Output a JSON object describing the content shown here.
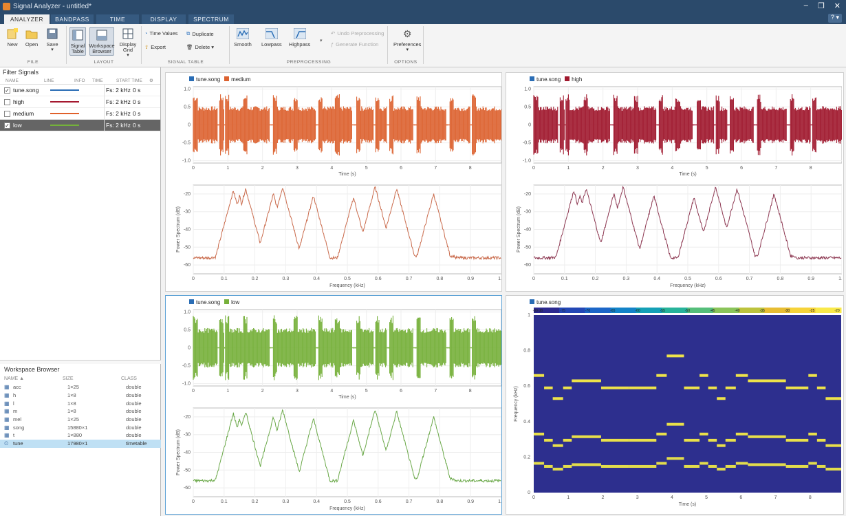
{
  "window": {
    "title": "Signal Analyzer - untitled*",
    "controls": [
      "–",
      "❐",
      "✕"
    ]
  },
  "tabs": [
    "ANALYZER",
    "BANDPASS",
    "TIME",
    "DISPLAY",
    "SPECTRUM"
  ],
  "help_label": "? ▾",
  "ribbon": {
    "buttons": {
      "new": "New",
      "open": "Open",
      "save": "Save",
      "signal_table": "Signal Table",
      "workspace_browser": "Workspace Browser",
      "display_grid": "Display Grid",
      "smooth": "Smooth",
      "lowpass": "Lowpass",
      "highpass": "Highpass",
      "preferences": "Preferences"
    },
    "small": {
      "time_values": "Time Values",
      "duplicate": "Duplicate",
      "export": "Export",
      "delete": "Delete ▾",
      "undo_preprocessing": "Undo Preprocessing",
      "generate_function": "Generate Function"
    },
    "sections": [
      "FILE",
      "LAYOUT",
      "SIGNAL TABLE",
      "PREPROCESSING",
      "OPTIONS"
    ]
  },
  "filter": {
    "title": "Filter Signals",
    "columns": [
      "NAME",
      "LINE",
      "INFO",
      "TIME",
      "START TIME"
    ],
    "rows": [
      {
        "check": "✓",
        "name": "tune.song",
        "color": "#2a6db5",
        "info": "Fs: 2 kHz",
        "start": "0 s"
      },
      {
        "check": "",
        "name": "high",
        "color": "#a5182f",
        "info": "Fs: 2 kHz",
        "start": "0 s"
      },
      {
        "check": "",
        "name": "medium",
        "color": "#e0602a",
        "info": "Fs: 2 kHz",
        "start": "0 s"
      },
      {
        "check": "✓",
        "name": "low",
        "color": "#74b23a",
        "info": "Fs: 2 kHz",
        "start": "0 s"
      }
    ]
  },
  "workspace": {
    "title": "Workspace Browser",
    "columns": [
      "NAME ▲",
      "SIZE",
      "CLASS"
    ],
    "rows": [
      {
        "name": "acc",
        "size": "1×25",
        "cls": "double"
      },
      {
        "name": "h",
        "size": "1×8",
        "cls": "double"
      },
      {
        "name": "l",
        "size": "1×8",
        "cls": "double"
      },
      {
        "name": "m",
        "size": "1×8",
        "cls": "double"
      },
      {
        "name": "mel",
        "size": "1×25",
        "cls": "double"
      },
      {
        "name": "song",
        "size": "15880×1",
        "cls": "double"
      },
      {
        "name": "t",
        "size": "1×880",
        "cls": "double"
      },
      {
        "name": "tune",
        "size": "17980×1",
        "cls": "timetable"
      }
    ]
  },
  "colors": {
    "blue": "#2a6db5",
    "medium": "#dc6230",
    "high": "#a0182e",
    "low": "#76b03a",
    "spec_bg": "#2d2f8e",
    "note": "#eee34a",
    "spec_medium": "#c96a4b",
    "spec_high": "#8c3650",
    "spec_low": "#6aa848"
  },
  "panels": [
    {
      "legend": [
        "tune.song",
        "medium"
      ],
      "time_xlabel": "Time (s)",
      "freq_xlabel": "Frequency (kHz)",
      "freq_ylabel": "Power Spectrum (dB)"
    },
    {
      "legend": [
        "tune.song",
        "high"
      ],
      "time_xlabel": "Time (s)",
      "freq_xlabel": "Frequency (kHz)",
      "freq_ylabel": "Power Spectrum (dB)"
    },
    {
      "legend": [
        "tune.song",
        "low"
      ],
      "time_xlabel": "Time (s)",
      "freq_xlabel": "Frequency (kHz)",
      "freq_ylabel": "Power Spectrum (dB)"
    },
    {
      "legend": [
        "tune.song"
      ],
      "xlabel": "Time (s)",
      "ylabel": "Frequency (kHz)"
    }
  ],
  "axes": {
    "time_x": [
      "0",
      "1",
      "2",
      "3",
      "4",
      "5",
      "6",
      "7",
      "8"
    ],
    "time_y": [
      "1.0",
      "0.5",
      "0",
      "-0.5",
      "-1.0"
    ],
    "freq_x": [
      "0",
      "0.1",
      "0.2",
      "0.3",
      "0.4",
      "0.5",
      "0.6",
      "0.7",
      "0.8",
      "0.9",
      "1.0"
    ],
    "freq_y": [
      "-20",
      "-30",
      "-40",
      "-50",
      "-60"
    ],
    "spec_y": [
      "1",
      "0.8",
      "0.6",
      "0.4",
      "0.2",
      "0"
    ],
    "spec_x": [
      "0",
      "1",
      "2",
      "3",
      "4",
      "5",
      "6",
      "7",
      "8"
    ],
    "colorbar": [
      "-80 dB",
      "-75",
      "-70",
      "-65",
      "-60",
      "-55",
      "-50",
      "-45",
      "-40",
      "-35",
      "-30",
      "-25",
      "-20"
    ]
  },
  "chart_data": [
    {
      "type": "line",
      "title": "",
      "xlabel": "Time (s)",
      "ylabel": "",
      "xlim": [
        0,
        8.9
      ],
      "ylim": [
        -1,
        1
      ],
      "series": [
        {
          "name": "tune.song"
        },
        {
          "name": "medium"
        }
      ],
      "amplitude_level": 0.4,
      "note_bursts": [
        [
          0.0,
          0.7
        ],
        [
          0.75,
          0.9
        ],
        [
          0.92,
          1.45
        ],
        [
          1.45,
          2.2
        ],
        [
          2.3,
          2.9
        ],
        [
          2.9,
          3.55
        ],
        [
          3.6,
          4.1
        ],
        [
          4.1,
          4.6
        ],
        [
          4.7,
          5.2
        ],
        [
          5.25,
          5.6
        ],
        [
          5.65,
          6.35
        ],
        [
          6.45,
          7.3
        ],
        [
          7.4,
          8.0
        ],
        [
          8.05,
          8.9
        ]
      ]
    },
    {
      "type": "line",
      "xlabel": "Frequency (kHz)",
      "ylabel": "Power Spectrum (dB)",
      "xlim": [
        0,
        1
      ],
      "ylim": [
        -65,
        -15
      ],
      "peaks": [
        [
          0.13,
          -18
        ],
        [
          0.15,
          -21
        ],
        [
          0.17,
          -17
        ],
        [
          0.26,
          -20
        ],
        [
          0.29,
          -16
        ],
        [
          0.39,
          -21
        ],
        [
          0.52,
          -22
        ],
        [
          0.59,
          -16
        ],
        [
          0.66,
          -17
        ],
        [
          0.78,
          -20
        ]
      ]
    },
    {
      "type": "heatmap",
      "xlabel": "Time (s)",
      "ylabel": "Frequency (kHz)",
      "xlim": [
        0,
        8.9
      ],
      "ylim": [
        0,
        1
      ],
      "notes": [
        [
          0,
          0.3,
          0.66
        ],
        [
          0.3,
          0.55,
          0.59
        ],
        [
          0.55,
          0.85,
          0.53
        ],
        [
          0.85,
          1.1,
          0.59
        ],
        [
          1.1,
          1.95,
          0.63
        ],
        [
          1.95,
          2.75,
          0.59
        ],
        [
          2.75,
          3.55,
          0.59
        ],
        [
          3.55,
          3.85,
          0.66
        ],
        [
          3.85,
          4.35,
          0.77
        ],
        [
          4.35,
          4.8,
          0.59
        ],
        [
          4.8,
          5.05,
          0.66
        ],
        [
          5.05,
          5.3,
          0.59
        ],
        [
          5.3,
          5.55,
          0.53
        ],
        [
          5.55,
          5.85,
          0.59
        ],
        [
          5.85,
          6.2,
          0.66
        ],
        [
          6.2,
          7.3,
          0.63
        ],
        [
          7.3,
          7.95,
          0.59
        ],
        [
          7.95,
          8.2,
          0.66
        ],
        [
          8.2,
          8.45,
          0.59
        ],
        [
          8.45,
          8.9,
          0.53
        ]
      ]
    }
  ]
}
